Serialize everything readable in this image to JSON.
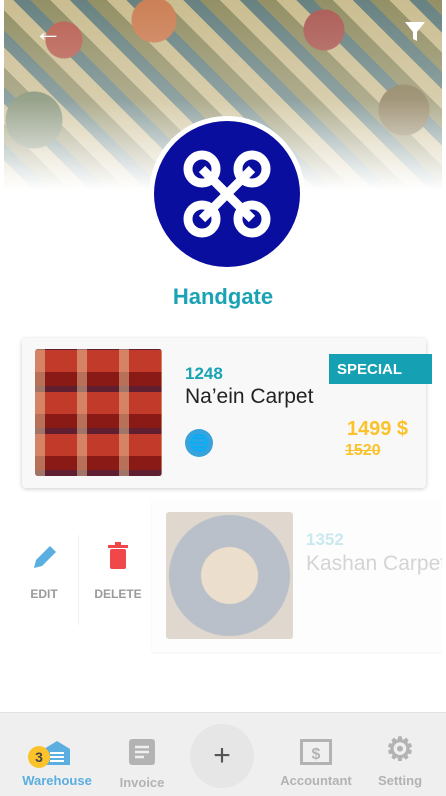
{
  "header": {
    "back_icon": "arrow-left-icon",
    "filter_icon": "filter-icon",
    "brand_name": "Handgate"
  },
  "products": [
    {
      "code": "1248",
      "name": "Na’ein Carpet",
      "tag": "SPECIAL",
      "price": "1499 $",
      "old_price": "1520"
    },
    {
      "code": "1352",
      "name": "Kashan Carpet"
    }
  ],
  "swipe_actions": {
    "edit": "EDIT",
    "delete": "DELETE"
  },
  "bottom_nav": {
    "items": [
      {
        "label": "Warehouse",
        "badge": "3",
        "active": true
      },
      {
        "label": "Invoice"
      },
      {
        "label": "+"
      },
      {
        "label": "Accountant"
      },
      {
        "label": "Setting"
      }
    ]
  },
  "colors": {
    "accent": "#1aa3b4",
    "price": "#fbc22b",
    "active_nav": "#5aaee0",
    "delete": "#f0474a"
  }
}
